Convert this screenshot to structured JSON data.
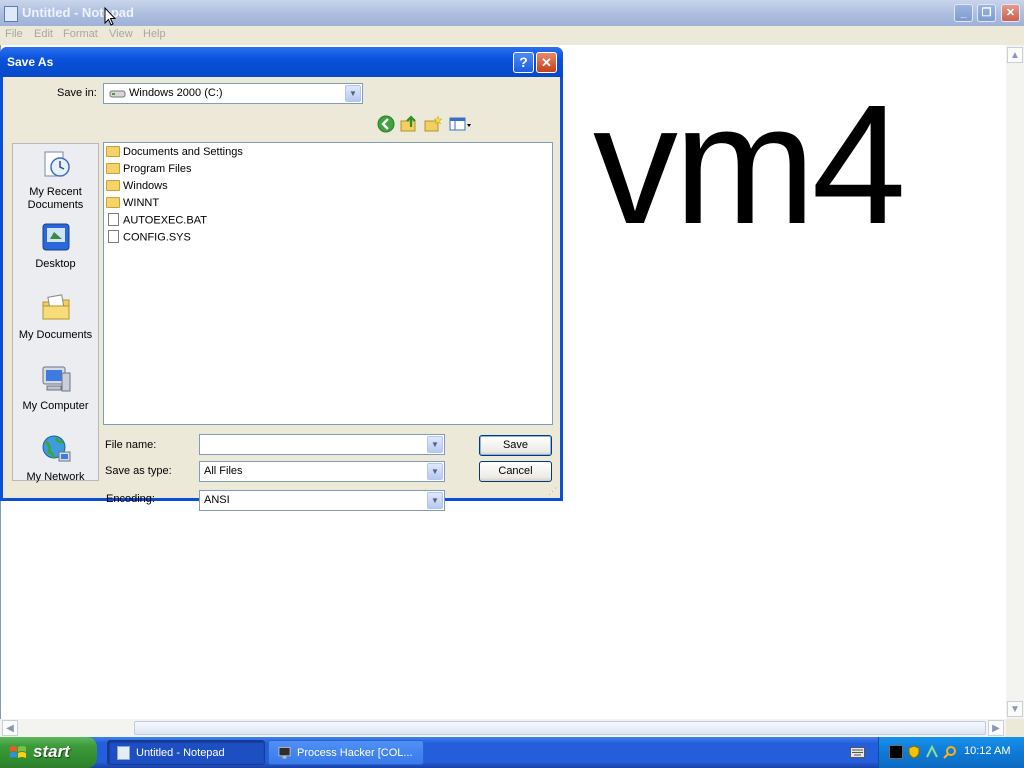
{
  "notepad": {
    "title": "Untitled - Notepad",
    "menu": [
      "File",
      "Edit",
      "Format",
      "View",
      "Help"
    ],
    "document_text": "vm4",
    "caption_buttons": {
      "minimize": "_",
      "restore": "❐",
      "close": "✕"
    }
  },
  "dialog": {
    "title": "Save As",
    "help_glyph": "?",
    "close_glyph": "✕",
    "save_in_label": "Save in:",
    "save_in_value": "Windows 2000 (C:)",
    "places": [
      {
        "label": "My Recent Documents",
        "icon": "recent-documents-icon"
      },
      {
        "label": "Desktop",
        "icon": "desktop-icon"
      },
      {
        "label": "My Documents",
        "icon": "my-documents-icon"
      },
      {
        "label": "My Computer",
        "icon": "my-computer-icon"
      },
      {
        "label": "My Network",
        "icon": "my-network-icon"
      }
    ],
    "files": [
      {
        "name": "Documents and Settings",
        "type": "folder"
      },
      {
        "name": "Program Files",
        "type": "folder"
      },
      {
        "name": "Windows",
        "type": "folder"
      },
      {
        "name": "WINNT",
        "type": "folder"
      },
      {
        "name": "AUTOEXEC.BAT",
        "type": "file"
      },
      {
        "name": "CONFIG.SYS",
        "type": "file"
      }
    ],
    "file_name_label": "File name:",
    "file_name_value": "",
    "save_as_type_label": "Save as type:",
    "save_as_type_value": "All Files",
    "encoding_label": "Encoding:",
    "encoding_value": "ANSI",
    "save_button": "Save",
    "cancel_button": "Cancel"
  },
  "taskbar": {
    "start_label": "start",
    "tasks": [
      {
        "label": "Untitled - Notepad",
        "active": true
      },
      {
        "label": "Process Hacker [COL...",
        "active": false
      }
    ],
    "clock": "10:12 AM"
  },
  "colors": {
    "dialog_title": "#0a52dc",
    "taskbar": "#245edb",
    "start_button": "#3c9a3a",
    "tray": "#0f7ad6"
  }
}
